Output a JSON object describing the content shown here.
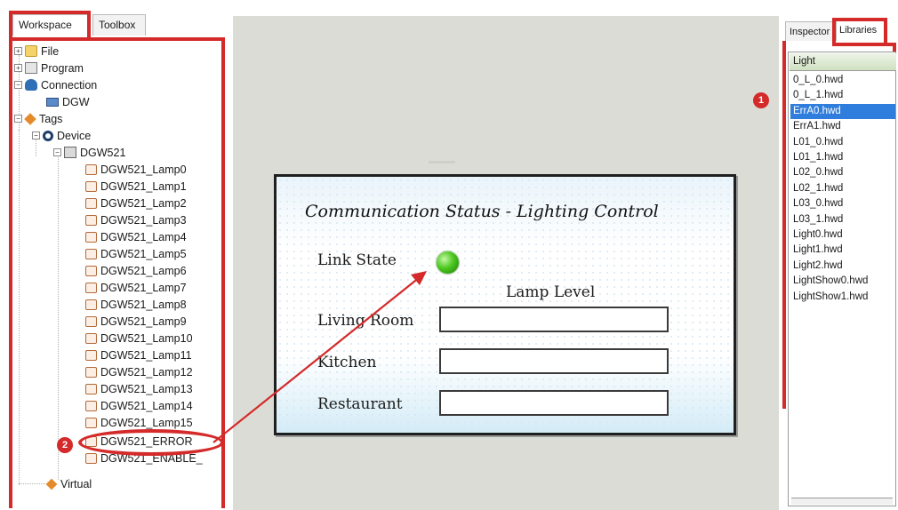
{
  "left_panel": {
    "tabs": [
      "Workspace",
      "Toolbox"
    ],
    "tree": {
      "file": "File",
      "program": "Program",
      "connection": "Connection",
      "dgw": "DGW",
      "tags": "Tags",
      "device": "Device",
      "dgw521": "DGW521",
      "lamps": [
        "DGW521_Lamp0",
        "DGW521_Lamp1",
        "DGW521_Lamp2",
        "DGW521_Lamp3",
        "DGW521_Lamp4",
        "DGW521_Lamp5",
        "DGW521_Lamp6",
        "DGW521_Lamp7",
        "DGW521_Lamp8",
        "DGW521_Lamp9",
        "DGW521_Lamp10",
        "DGW521_Lamp11",
        "DGW521_Lamp12",
        "DGW521_Lamp13",
        "DGW521_Lamp14",
        "DGW521_Lamp15"
      ],
      "error": "DGW521_ERROR",
      "enable": "DGW521_ENABLE_",
      "virtual": "Virtual"
    }
  },
  "hmi": {
    "title": "Communication Status - Lighting Control",
    "link_state_label": "Link State",
    "lamp_level_header": "Lamp Level",
    "rooms": [
      "Living Room",
      "Kitchen",
      "Restaurant"
    ]
  },
  "right_panel": {
    "tabs": [
      "Inspector",
      "Libraries"
    ],
    "header": "Light",
    "items": [
      "0_L_0.hwd",
      "0_L_1.hwd",
      "ErrA0.hwd",
      "ErrA1.hwd",
      "L01_0.hwd",
      "L01_1.hwd",
      "L02_0.hwd",
      "L02_1.hwd",
      "L03_0.hwd",
      "L03_1.hwd",
      "Light0.hwd",
      "Light1.hwd",
      "Light2.hwd",
      "LightShow0.hwd",
      "LightShow1.hwd"
    ],
    "selected_index": 2
  },
  "annotations": {
    "badge_1": "1",
    "badge_2": "2",
    "highlight_color": "#d42a2a"
  }
}
